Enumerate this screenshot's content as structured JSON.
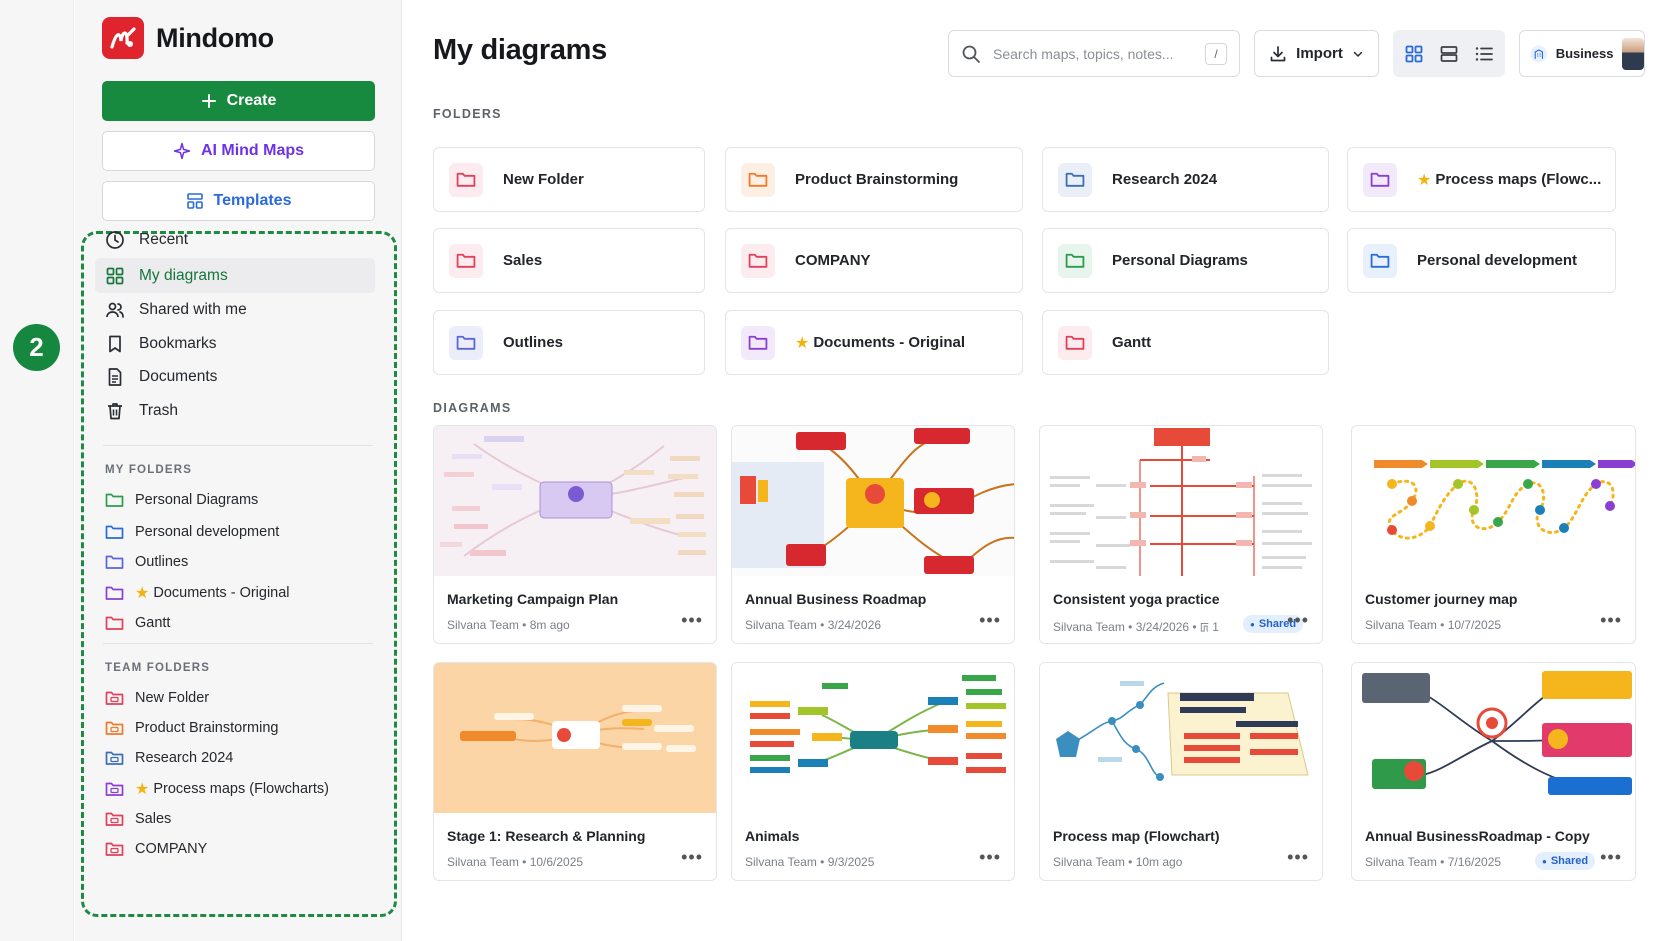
{
  "app": {
    "name": "Mindomo",
    "step_number": "2"
  },
  "sidebar": {
    "create_label": "Create",
    "ai_label": "AI Mind Maps",
    "templates_label": "Templates",
    "nav": [
      {
        "label": "Recent",
        "icon": "clock-icon"
      },
      {
        "label": "My diagrams",
        "icon": "grid-icon",
        "active": true
      },
      {
        "label": "Shared with me",
        "icon": "people-icon"
      },
      {
        "label": "Bookmarks",
        "icon": "bookmark-icon"
      },
      {
        "label": "Documents",
        "icon": "document-icon"
      },
      {
        "label": "Trash",
        "icon": "trash-icon"
      }
    ],
    "my_folders_heading": "MY FOLDERS",
    "my_folders": [
      {
        "label": "Personal Diagrams",
        "color": "#2e9a4f"
      },
      {
        "label": "Personal development",
        "color": "#2a6bd8"
      },
      {
        "label": "Outlines",
        "color": "#5a66d6"
      },
      {
        "label": "Documents - Original",
        "color": "#8a3fd1",
        "starred": true
      },
      {
        "label": "Gantt",
        "color": "#e0405a"
      }
    ],
    "team_folders_heading": "TEAM FOLDERS",
    "team_folders": [
      {
        "label": "New Folder",
        "color": "#e0405a"
      },
      {
        "label": "Product Brainstorming",
        "color": "#f07a2a"
      },
      {
        "label": "Research 2024",
        "color": "#3b6fb5"
      },
      {
        "label": "Process maps (Flowcharts)",
        "color": "#8a3fd1",
        "starred": true
      },
      {
        "label": "Sales",
        "color": "#e0405a"
      },
      {
        "label": "COMPANY",
        "color": "#e0405a"
      }
    ]
  },
  "header": {
    "title": "My diagrams",
    "search_placeholder": "Search maps, topics, notes...",
    "search_shortcut": "/",
    "import_label": "Import",
    "plan_label": "Business"
  },
  "folders": {
    "heading": "FOLDERS",
    "items": [
      {
        "label": "New Folder",
        "color": "#e0405a",
        "bg": "#fdecef"
      },
      {
        "label": "Product Brainstorming",
        "color": "#f07a2a",
        "bg": "#fdefe4"
      },
      {
        "label": "Research 2024",
        "color": "#3b6fb5",
        "bg": "#e9eef7"
      },
      {
        "label": "Process maps (Flowc...",
        "color": "#8a3fd1",
        "bg": "#f2eafb",
        "starred": true
      },
      {
        "label": "Sales",
        "color": "#e0405a",
        "bg": "#fdecef"
      },
      {
        "label": "COMPANY",
        "color": "#e0405a",
        "bg": "#fdecef"
      },
      {
        "label": "Personal Diagrams",
        "color": "#2e9a4f",
        "bg": "#e8f5ec"
      },
      {
        "label": "Personal development",
        "color": "#2a6bd8",
        "bg": "#e8f0fc"
      },
      {
        "label": "Outlines",
        "color": "#5a66d6",
        "bg": "#ecedfa"
      },
      {
        "label": "Documents - Original",
        "color": "#8a3fd1",
        "bg": "#f2eafb",
        "starred": true
      },
      {
        "label": "Gantt",
        "color": "#e0405a",
        "bg": "#fdecef"
      }
    ]
  },
  "diagrams": {
    "heading": "DIAGRAMS",
    "items": [
      {
        "title": "Marketing Campaign Plan",
        "meta": "Silvana Team • 8m ago"
      },
      {
        "title": "Annual Business Roadmap",
        "meta": "Silvana Team • 3/24/2026"
      },
      {
        "title": "Consistent yoga practice",
        "meta": "Silvana Team • 3/24/2026 • ꡚ 1",
        "shared": "Shared"
      },
      {
        "title": "Customer journey map",
        "meta": "Silvana Team • 10/7/2025"
      },
      {
        "title": "Stage 1: Research & Planning",
        "meta": "Silvana Team • 10/6/2025"
      },
      {
        "title": "Animals",
        "meta": "Silvana Team • 9/3/2025"
      },
      {
        "title": "Process map (Flowchart)",
        "meta": "Silvana Team • 10m ago"
      },
      {
        "title": "Annual BusinessRoadmap - Copy",
        "meta": "Silvana Team • 7/16/2025",
        "shared": "Shared"
      }
    ],
    "more_label": "•••"
  },
  "colors": {
    "brand_red": "#e0242e",
    "primary_green": "#178a3f",
    "ai_purple": "#6d33e6",
    "link_blue": "#2a6bd8"
  }
}
